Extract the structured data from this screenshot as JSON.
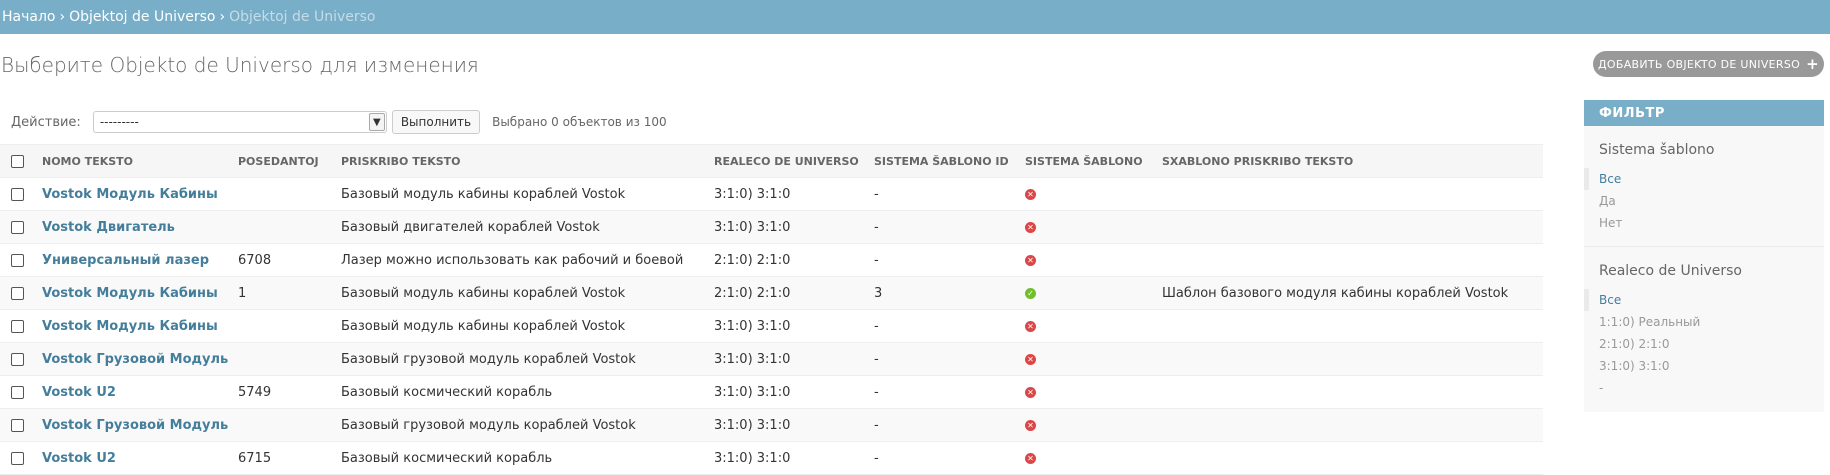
{
  "breadcrumbs": {
    "home": "Начало",
    "section": "Objektoj de Universo",
    "current": "Objektoj de Universo"
  },
  "page_title": "Выберите Objekto de Universo для изменения",
  "add_button_label": "ДОБАВИТЬ OBJEKTO DE UNIVERSO",
  "actions": {
    "label": "Действие:",
    "select_value": "---------",
    "go_label": "Выполнить",
    "counter": "Выбрано 0 объектов из 100"
  },
  "table": {
    "columns": [
      "NOMO TEKSTO",
      "POSEDANTOJ",
      "PRISKRIBO TEKSTO",
      "REALECO DE UNIVERSO",
      "SISTEMA ŠABLONO ID",
      "SISTEMA ŠABLONO",
      "SXABLONO PRISKRIBO TEKSTO"
    ],
    "rows": [
      {
        "name": "Vostok Модуль Кабины",
        "owner": "",
        "desc": "Базовый модуль кабины кораблей Vostok",
        "reality": "3:1:0) 3:1:0",
        "template_id": "-",
        "template": false,
        "template_desc": ""
      },
      {
        "name": "Vostok Двигатель",
        "owner": "",
        "desc": "Базовый двигателей кораблей Vostok",
        "reality": "3:1:0) 3:1:0",
        "template_id": "-",
        "template": false,
        "template_desc": ""
      },
      {
        "name": "Универсальный лазер",
        "owner": "6708",
        "desc": "Лазер можно использовать как рабочий и боевой",
        "reality": "2:1:0) 2:1:0",
        "template_id": "-",
        "template": false,
        "template_desc": ""
      },
      {
        "name": "Vostok Модуль Кабины",
        "owner": "1",
        "desc": "Базовый модуль кабины кораблей Vostok",
        "reality": "2:1:0) 2:1:0",
        "template_id": "3",
        "template": true,
        "template_desc": "Шаблон базового модуля кабины кораблей Vostok"
      },
      {
        "name": "Vostok Модуль Кабины",
        "owner": "",
        "desc": "Базовый модуль кабины кораблей Vostok",
        "reality": "3:1:0) 3:1:0",
        "template_id": "-",
        "template": false,
        "template_desc": ""
      },
      {
        "name": "Vostok Грузовой Модуль",
        "owner": "",
        "desc": "Базовый грузовой модуль кораблей Vostok",
        "reality": "3:1:0) 3:1:0",
        "template_id": "-",
        "template": false,
        "template_desc": ""
      },
      {
        "name": "Vostok U2",
        "owner": "5749",
        "desc": "Базовый космический корабль",
        "reality": "3:1:0) 3:1:0",
        "template_id": "-",
        "template": false,
        "template_desc": ""
      },
      {
        "name": "Vostok Грузовой Модуль",
        "owner": "",
        "desc": "Базовый грузовой модуль кораблей Vostok",
        "reality": "3:1:0) 3:1:0",
        "template_id": "-",
        "template": false,
        "template_desc": ""
      },
      {
        "name": "Vostok U2",
        "owner": "6715",
        "desc": "Базовый космический корабль",
        "reality": "3:1:0) 3:1:0",
        "template_id": "-",
        "template": false,
        "template_desc": ""
      }
    ]
  },
  "filter": {
    "title": "ФИЛЬТР",
    "groups": [
      {
        "title": "Sistema šablono",
        "options": [
          "Все",
          "Да",
          "Нет"
        ],
        "selected": 0
      },
      {
        "title": "Realeco de Universo",
        "options": [
          "Все",
          "1:1:0) Реальный",
          "2:1:0) 2:1:0",
          "3:1:0) 3:1:0",
          "-"
        ],
        "selected": 0
      }
    ]
  },
  "colors": {
    "header_bar": "#79aec8",
    "link": "#447e9b",
    "no_icon": "#dd4646",
    "yes_icon": "#70bf2b"
  },
  "icons": {
    "add": "plus-icon",
    "select_arrow": "chevron-down-icon",
    "false_status": "cross-circle-icon",
    "true_status": "check-circle-icon"
  }
}
